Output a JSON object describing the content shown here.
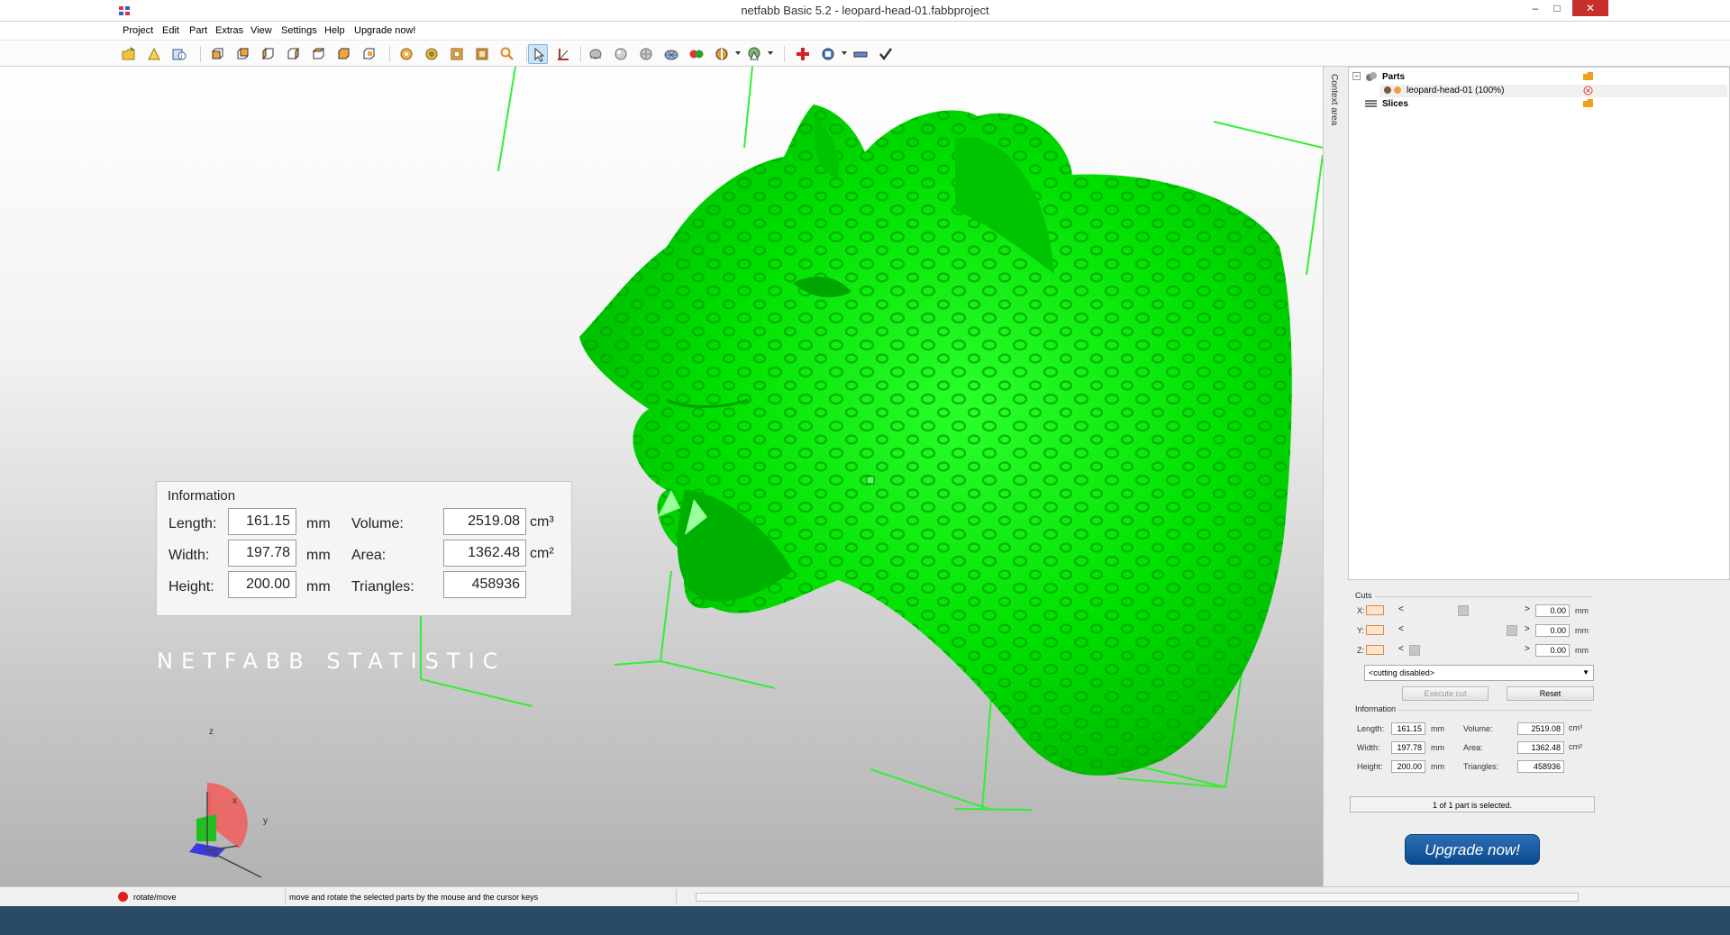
{
  "window": {
    "title": "netfabb Basic 5.2 - leopard-head-01.fabbproject",
    "minimize": "–",
    "maximize": "□",
    "close": "✕"
  },
  "menu": [
    "Project",
    "Edit",
    "Part",
    "Extras",
    "View",
    "Settings",
    "Help",
    "Upgrade now!"
  ],
  "context_area_label": "Context area",
  "tree": {
    "parts_label": "Parts",
    "part_item": "leopard-head-01 (100%)",
    "slices_label": "Slices"
  },
  "cuts": {
    "title": "Cuts",
    "axes": [
      {
        "label": "X:",
        "value": "0.00",
        "unit": "mm"
      },
      {
        "label": "Y:",
        "value": "0.00",
        "unit": "mm"
      },
      {
        "label": "Z:",
        "value": "0.00",
        "unit": "mm"
      }
    ],
    "left_arrow": "<",
    "right_arrow": ">",
    "cutting_select": "<cutting disabled>",
    "execute_cut": "Execute cut",
    "reset": "Reset"
  },
  "info": {
    "title": "Information",
    "length_label": "Length:",
    "length": "161.15",
    "width_label": "Width:",
    "width": "197.78",
    "height_label": "Height:",
    "height": "200.00",
    "volume_label": "Volume:",
    "volume": "2519.08",
    "area_label": "Area:",
    "area": "1362.48",
    "triangles_label": "Triangles:",
    "triangles": "458936",
    "mm": "mm",
    "cm3": "cm³",
    "cm2": "cm²"
  },
  "selection_status": "1 of 1 part is selected.",
  "upgrade_button": "Upgrade now!",
  "statistic_label": "NETFABB STATISTIC",
  "axis_indicator": {
    "z": "z",
    "x": "x",
    "y": "y"
  },
  "statusbar": {
    "mode": "rotate/move",
    "hint": "move and rotate the selected parts by the mouse and the cursor keys"
  },
  "colors": {
    "model": "#00dd00",
    "bounding_box": "#33ee33",
    "upgrade_button": "#1d5da3",
    "status_dot": "#e51c1c"
  },
  "icons": [
    "open-icon",
    "import-icon",
    "info-icon",
    "view-front-icon",
    "view-back-icon",
    "view-left-icon",
    "view-right-icon",
    "view-top-icon",
    "view-bottom-icon",
    "view-perspective-icon",
    "rotate-view-icon",
    "zoom-all-icon",
    "zoom-selection-icon",
    "zoom-icon",
    "select-arrow-icon",
    "measure-icon",
    "shading-icon",
    "lighting-icon",
    "texture-icon",
    "mesh-icon",
    "color-icon",
    "section-icon",
    "pointer-icon",
    "repair-icon",
    "cut-tool-icon",
    "ruler-icon",
    "checkmark-icon"
  ]
}
